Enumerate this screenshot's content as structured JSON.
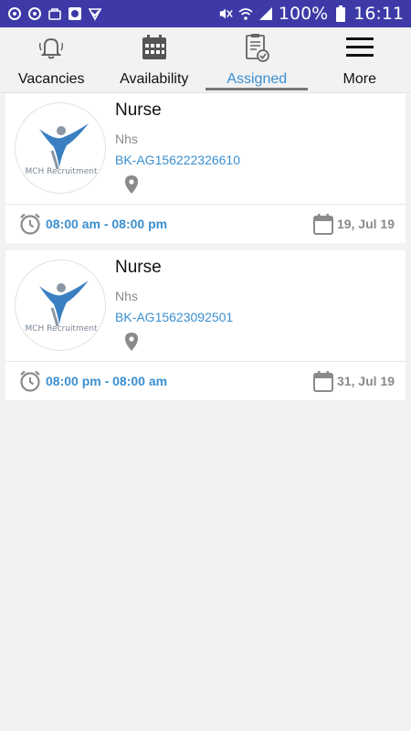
{
  "status_bar": {
    "battery": "100%",
    "time": "16:11",
    "left_icons": [
      "sync-icon",
      "sync-icon",
      "bag-icon",
      "app-icon",
      "check-icon"
    ],
    "right_icons": [
      "mute-icon",
      "wifi-icon",
      "signal-icon",
      "battery-icon"
    ]
  },
  "tabs": [
    {
      "label": "Vacancies",
      "icon": "bell-icon",
      "active": false
    },
    {
      "label": "Availability",
      "icon": "calendar-icon",
      "active": false
    },
    {
      "label": "Assigned",
      "icon": "clipboard-check-icon",
      "active": true
    },
    {
      "label": "More",
      "icon": "menu-icon",
      "active": false
    }
  ],
  "cards": [
    {
      "logo_text": "MCH Recruitment",
      "title": "Nurse",
      "company": "Nhs",
      "ref": "BK-AG156222326610",
      "time_range": "08:00 am - 08:00 pm",
      "date": "19, Jul 19"
    },
    {
      "logo_text": "MCH Recruitment",
      "title": "Nurse",
      "company": "Nhs",
      "ref": "BK-AG15623092501",
      "time_range": "08:00 pm - 08:00 am",
      "date": "31, Jul 19"
    }
  ],
  "colors": {
    "status_bar": "#3d3aa8",
    "accent": "#3b8fd0",
    "muted": "#8a8a8a"
  }
}
